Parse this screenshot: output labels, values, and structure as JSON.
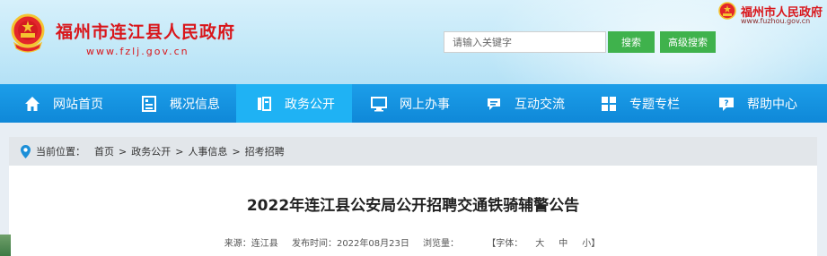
{
  "header": {
    "title": "福州市连江县人民政府",
    "url": "www.fzlj.gov.cn",
    "city_link": {
      "name": "福州市人民政府",
      "url": "www.fuzhou.gov.cn"
    },
    "search": {
      "placeholder": "请输入关键字",
      "search_label": "搜索",
      "advanced_label": "高级搜索"
    }
  },
  "nav": {
    "items": [
      {
        "label": "网站首页",
        "icon": "home-icon"
      },
      {
        "label": "概况信息",
        "icon": "document-icon"
      },
      {
        "label": "政务公开",
        "icon": "open-government-icon",
        "active": true
      },
      {
        "label": "网上办事",
        "icon": "monitor-icon"
      },
      {
        "label": "互动交流",
        "icon": "chat-icon"
      },
      {
        "label": "专题专栏",
        "icon": "grid-icon"
      },
      {
        "label": "帮助中心",
        "icon": "help-icon"
      }
    ]
  },
  "breadcrumb": {
    "label": "当前位置：",
    "items": [
      "首页",
      "政务公开",
      "人事信息",
      "招考招聘"
    ],
    "separator": ">"
  },
  "article": {
    "title": "2022年连江县公安局公开招聘交通铁骑辅警公告",
    "source": "来源：连江县",
    "published": "发布时间：2022年08月23日",
    "views": "浏览量：",
    "font_size_label": "【字体：",
    "size_large": "大",
    "size_medium": "中",
    "size_small": "小】"
  },
  "colors": {
    "brand_red": "#d9161b",
    "nav_blue": "#0f88d8",
    "nav_active": "#1fb2f4",
    "button_green": "#3fb24c"
  }
}
